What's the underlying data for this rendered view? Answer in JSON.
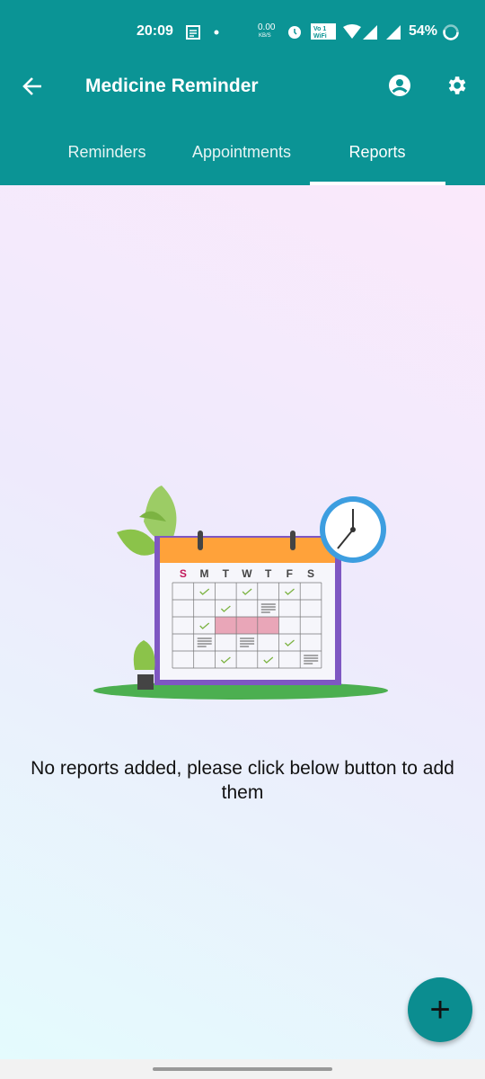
{
  "status_bar": {
    "time": "20:09",
    "net_speed": "0.00",
    "net_unit": "KB/S",
    "battery": "54%",
    "icons": [
      "notes-icon",
      "dot-icon",
      "alarm-icon",
      "vowifi-icon",
      "wifi-icon",
      "signal-icon",
      "signal-icon",
      "battery-ring-icon"
    ]
  },
  "app_bar": {
    "title": "Medicine Reminder",
    "back_icon": "arrow-left-icon",
    "profile_icon": "account-circle-icon",
    "settings_icon": "gear-icon"
  },
  "tabs": [
    {
      "label": "Reminders"
    },
    {
      "label": "Appointments"
    },
    {
      "label": "Reports",
      "selected": true
    }
  ],
  "calendar_days": [
    "S",
    "M",
    "T",
    "W",
    "T",
    "F",
    "S"
  ],
  "empty_state": {
    "message": "No reports added, please click below button to add them"
  },
  "fab": {
    "label": "+",
    "icon": "plus-icon"
  },
  "colors": {
    "primary": "#0b9495",
    "fab": "#0b8d90"
  }
}
